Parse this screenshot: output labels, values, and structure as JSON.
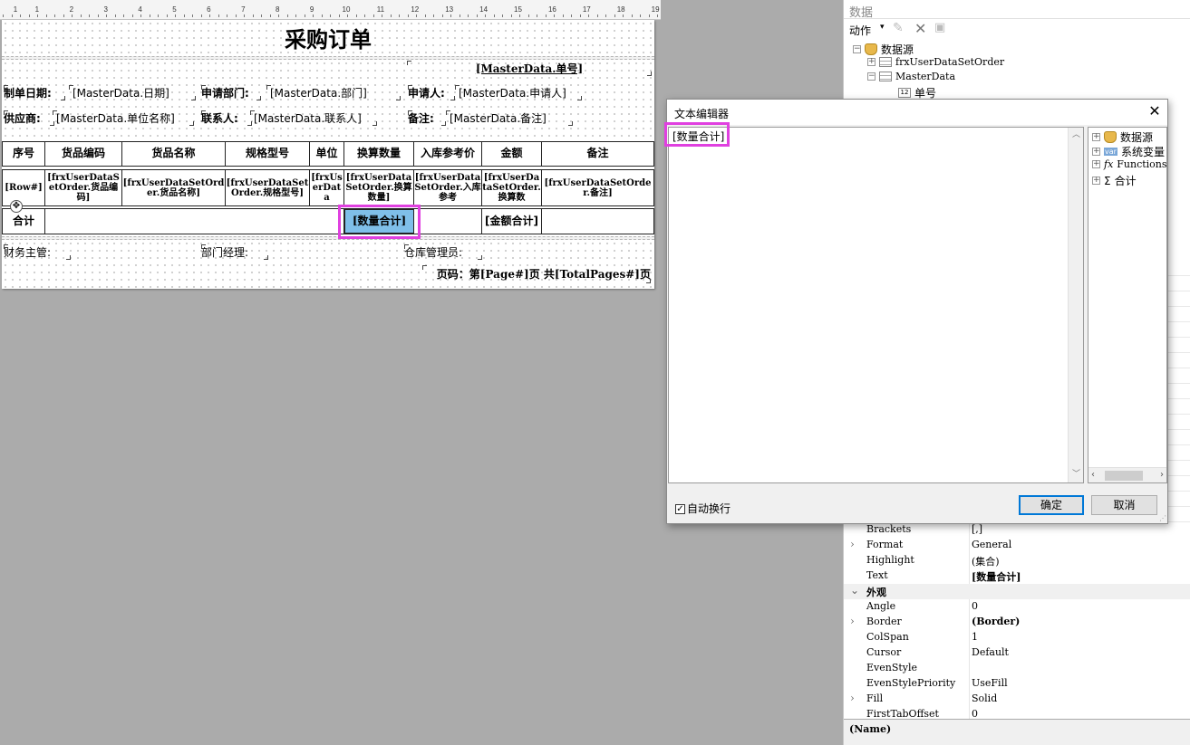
{
  "ruler": {
    "numbers": [
      "1",
      "1",
      "2",
      "3",
      "4",
      "5",
      "6",
      "7",
      "8",
      "9",
      "10",
      "11",
      "12",
      "13",
      "14",
      "15",
      "16",
      "17",
      "18",
      "19"
    ]
  },
  "report": {
    "title": "采购订单",
    "order_no": "[MasterData.单号]",
    "info": {
      "date_label": "制单日期:",
      "date_value": "[MasterData.日期]",
      "dept_label": "申请部门:",
      "dept_value": "[MasterData.部门]",
      "applicant_label": "申请人:",
      "applicant_value": "[MasterData.申请人]",
      "supplier_label": "供应商:",
      "supplier_value": "[MasterData.单位名称]",
      "contact_label": "联系人:",
      "contact_value": "[MasterData.联系人]",
      "remark_label": "备注:",
      "remark_value": "[MasterData.备注]"
    },
    "columns": [
      "序号",
      "货品编码",
      "货品名称",
      "规格型号",
      "单位",
      "换算数量",
      "入库参考价",
      "金额",
      "备注"
    ],
    "data_row": [
      "[Row#]",
      "[frxUserDataSetOrder.货品编码]",
      "[frxUserDataSetOrder.货品名称]",
      "[frxUserDataSetOrder.规格型号]",
      "[frxUserData",
      "[frxUserDataSetOrder.换算数量]",
      "[frxUserDataSetOrder.入库参考",
      "[frxUserDataSetOrder.换算数",
      "[frxUserDataSetOrder.备注]"
    ],
    "total_row": {
      "label": "合计",
      "qty_sum": "[数量合计]",
      "amount_sum": "[金额合计]"
    },
    "footer": {
      "finance": "财务主管:",
      "manager": "部门经理:",
      "warehouse": "仓库管理员:",
      "page_no": "页码：第[Page#]页 共[TotalPages#]页"
    }
  },
  "data_panel": {
    "title": "数据",
    "actions_label": "动作",
    "tree": {
      "root": "数据源",
      "ds1": "frxUserDataSetOrder",
      "ds2": "MasterData",
      "field1": "单号"
    }
  },
  "properties": [
    {
      "key": "Brackets",
      "value": "[,]",
      "expand": false,
      "bold": false
    },
    {
      "key": "Format",
      "value": "General",
      "expand": true,
      "bold": false
    },
    {
      "key": "Highlight",
      "value": "(集合)",
      "expand": false,
      "bold": false
    },
    {
      "key": "Text",
      "value": "[数量合计]",
      "expand": false,
      "bold": true
    },
    {
      "key": "外观",
      "value": "",
      "expand": false,
      "bold": true,
      "category": true
    },
    {
      "key": "Angle",
      "value": "0",
      "expand": false,
      "bold": false
    },
    {
      "key": "Border",
      "value": "(Border)",
      "expand": true,
      "bold": true
    },
    {
      "key": "ColSpan",
      "value": "1",
      "expand": false,
      "bold": false
    },
    {
      "key": "Cursor",
      "value": "Default",
      "expand": false,
      "bold": false
    },
    {
      "key": "EvenStyle",
      "value": "",
      "expand": false,
      "bold": false
    },
    {
      "key": "EvenStylePriority",
      "value": "UseFill",
      "expand": false,
      "bold": false
    },
    {
      "key": "Fill",
      "value": "Solid",
      "expand": true,
      "bold": false
    },
    {
      "key": "FirstTabOffset",
      "value": "0",
      "expand": false,
      "bold": false
    }
  ],
  "name_bar": "(Name)",
  "dialog": {
    "title": "文本编辑器",
    "close": "✕",
    "text": "[数量合计]",
    "tree": {
      "datasource": "数据源",
      "sysvar": "系统变量",
      "functions": "Functions",
      "totals": "合计"
    },
    "wrap_label": "自动换行",
    "ok": "确定",
    "cancel": "取消"
  },
  "colors": {
    "highlight": "#e040e0",
    "selected_cell": "#7fbfe9",
    "primary_button": "#0078d7"
  }
}
